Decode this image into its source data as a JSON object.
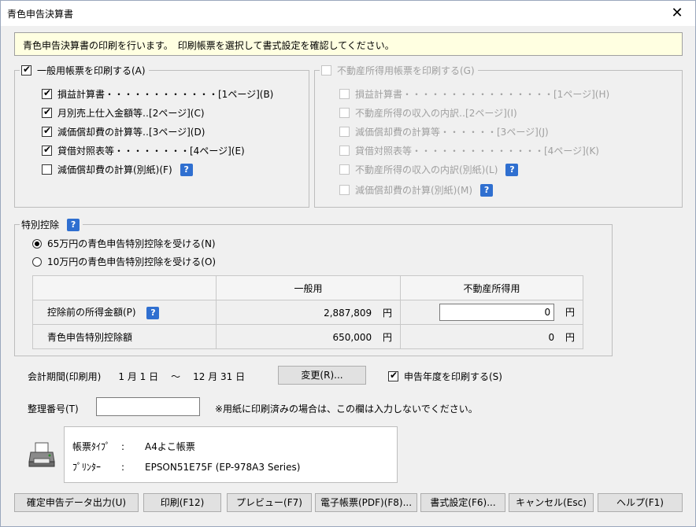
{
  "window": {
    "title": "青色申告決算書",
    "close": "✕"
  },
  "banner": "青色申告決算書の印刷を行います。　印刷帳票を選択して書式設定を確認してください。",
  "general": {
    "title": "一般用帳票を印刷する(A)",
    "items": [
      "損益計算書・・・・・・・・・・・・[1ページ](B)",
      "月別売上仕入金額等‥[2ページ](C)",
      "減価償却費の計算等‥[3ページ](D)",
      "貸借対照表等・・・・・・・・[4ページ](E)",
      "減価償却費の計算(別紙)(F)"
    ]
  },
  "realestate": {
    "title": "不動産所得用帳票を印刷する(G)",
    "items": [
      "損益計算書・・・・・・・・・・・・・・・・[1ページ](H)",
      "不動産所得の収入の内訳‥[2ページ](I)",
      "減価償却費の計算等・・・・・・[3ページ](J)",
      "貸借対照表等・・・・・・・・・・・・・・[4ページ](K)",
      "不動産所得の収入の内訳(別紙)(L)",
      "減価償却費の計算(別紙)(M)"
    ]
  },
  "deduction": {
    "title": "特別控除",
    "options": [
      "65万円の青色申告特別控除を受ける(N)",
      "10万円の青色申告特別控除を受ける(O)"
    ],
    "columns": [
      "一般用",
      "不動産所得用"
    ],
    "rows": [
      {
        "label": "控除前の所得金額(P)",
        "general": "2,887,809",
        "realestate": "0"
      },
      {
        "label": "青色申告特別控除額",
        "general": "650,000",
        "realestate": "0"
      }
    ],
    "unit": "円"
  },
  "period": {
    "label": "会計期間(印刷用)",
    "start": "1 月 1 日",
    "sep": "〜",
    "end": "12 月 31 日",
    "change_button": "変更(R)...",
    "print_year": "申告年度を印刷する(S)"
  },
  "seiri": {
    "label": "整理番号(T)",
    "value": "",
    "note": "※用紙に印刷済みの場合は、この欄は入力しないでください。"
  },
  "printer": {
    "type_label": "帳票ﾀｲﾌﾟ",
    "type_value": "A4よこ帳票",
    "printer_label": "ﾌﾟﾘﾝﾀｰ",
    "printer_value": "EPSON51E75F (EP-978A3 Series)",
    "colon": ":"
  },
  "buttons": [
    "確定申告データ出力(U)",
    "印刷(F12)",
    "プレビュー(F7)",
    "電子帳票(PDF)(F8)...",
    "書式設定(F6)...",
    "キャンセル(Esc)",
    "ヘルプ(F1)"
  ],
  "help_glyph": "?"
}
